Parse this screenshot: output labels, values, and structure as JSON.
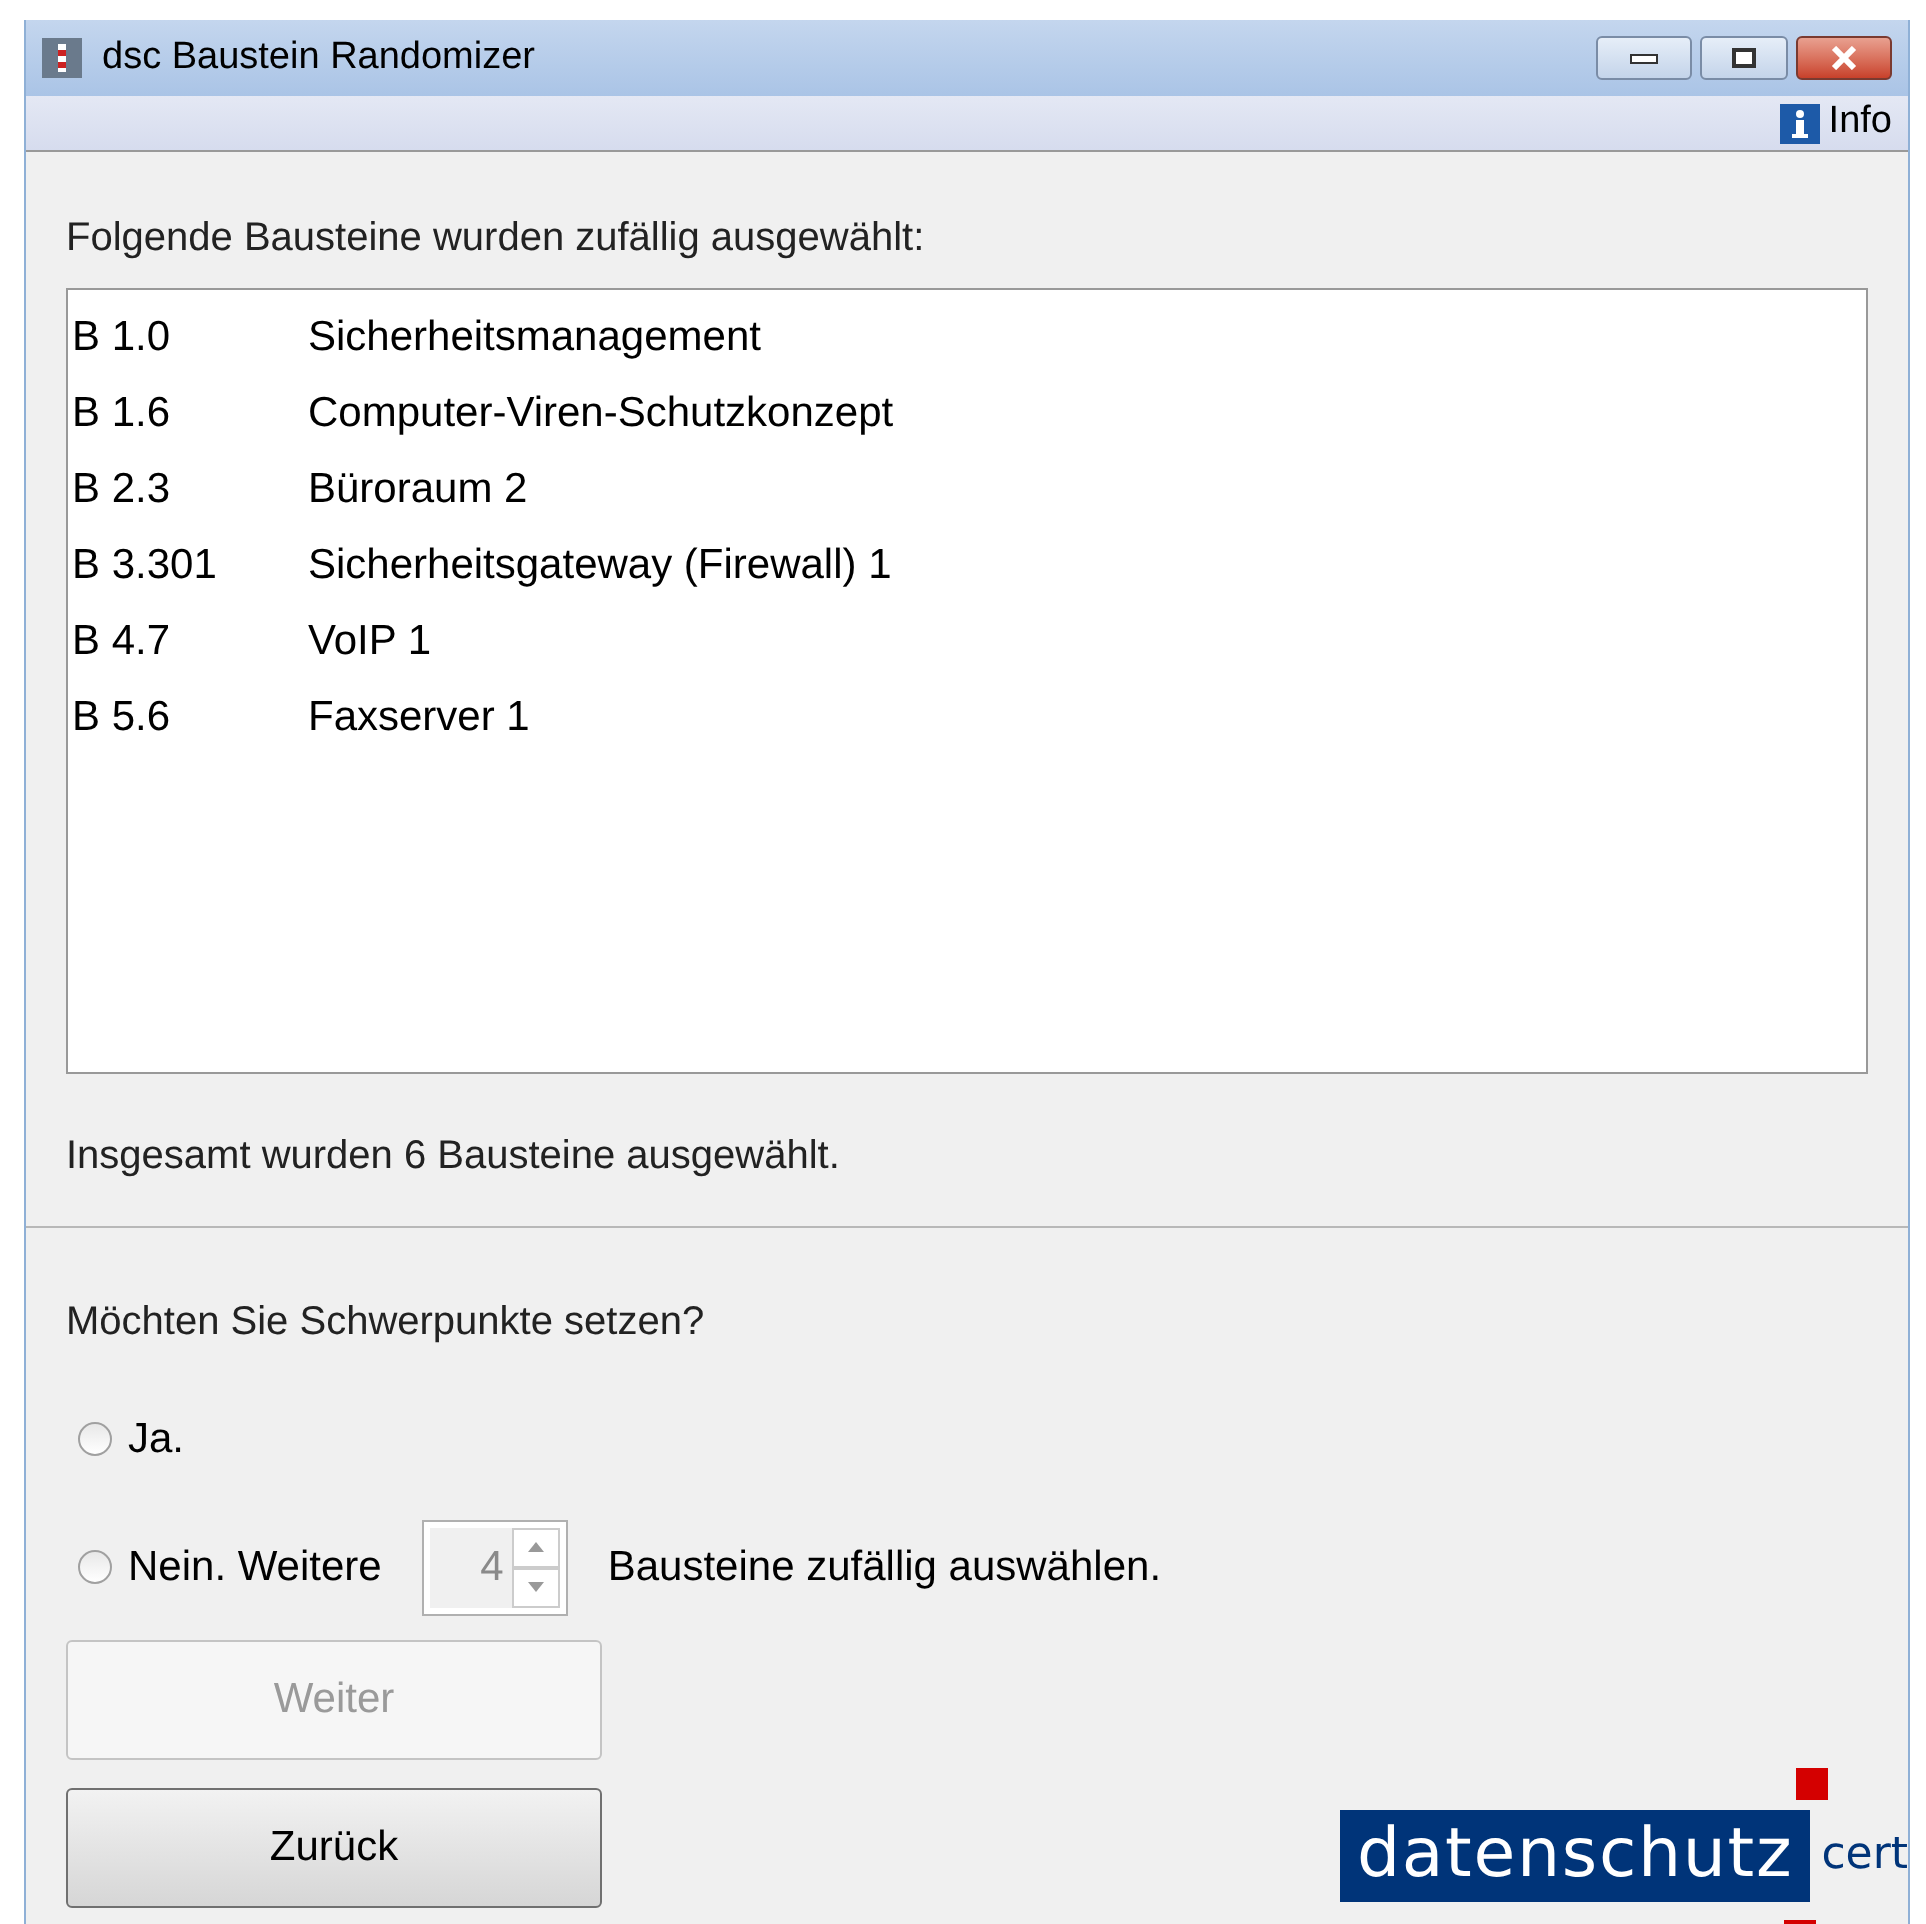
{
  "window": {
    "title": "dsc Baustein Randomizer"
  },
  "menu": {
    "info": "Info"
  },
  "heading": "Folgende Bausteine wurden zufällig ausgewählt:",
  "list": [
    {
      "code": "B 1.0",
      "name": "Sicherheitsmanagement"
    },
    {
      "code": "B 1.6",
      "name": "Computer-Viren-Schutzkonzept"
    },
    {
      "code": "B 2.3",
      "name": "Büroraum 2"
    },
    {
      "code": "B 3.301",
      "name": "Sicherheitsgateway (Firewall) 1"
    },
    {
      "code": "B 4.7",
      "name": "VoIP 1"
    },
    {
      "code": "B 5.6",
      "name": "Faxserver 1"
    }
  ],
  "summary": "Insgesamt wurden 6 Bausteine ausgewählt.",
  "question": "Möchten Sie Schwerpunkte setzen?",
  "options": [
    {
      "label": "Ja.",
      "selected": false
    },
    {
      "label": "Nein. Weitere",
      "selected": false,
      "spinner": {
        "value": "4",
        "disabled": true
      },
      "suffix": "Bausteine zufällig auswählen."
    }
  ],
  "buttons": [
    {
      "label": "Weiter",
      "disabled": true
    },
    {
      "label": "Zurück",
      "disabled": false
    }
  ],
  "logo": {
    "main": "datenschutz",
    "sub": "cert"
  }
}
